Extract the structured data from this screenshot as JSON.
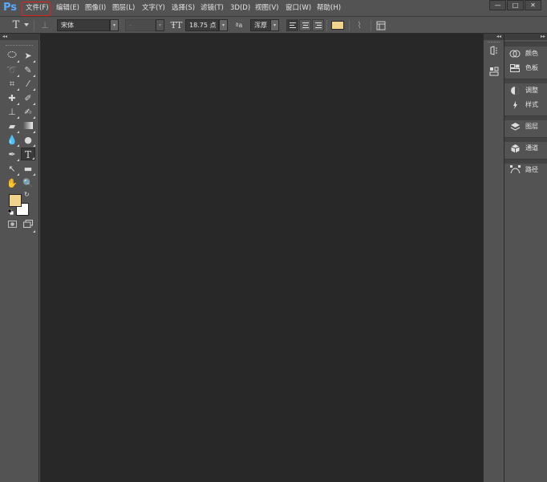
{
  "app": {
    "logo_text": "Ps"
  },
  "menu": {
    "items": [
      {
        "label": "文件(F)"
      },
      {
        "label": "编辑(E)"
      },
      {
        "label": "图像(I)"
      },
      {
        "label": "图层(L)"
      },
      {
        "label": "文字(Y)"
      },
      {
        "label": "选择(S)"
      },
      {
        "label": "滤镜(T)"
      },
      {
        "label": "3D(D)"
      },
      {
        "label": "视图(V)"
      },
      {
        "label": "窗口(W)"
      },
      {
        "label": "帮助(H)"
      }
    ],
    "highlighted_item": "文件(F)",
    "highlight_color": "#e0241b"
  },
  "window_controls": {
    "minimize": "—",
    "maximize": "□",
    "close": "✕"
  },
  "options_bar": {
    "tool_icon": "T",
    "font_family": "宋体",
    "font_style": "-",
    "font_size": "18.75 点",
    "antialias": "浑厚",
    "aa_icon_text": "ªa",
    "text_color": "#f2d38c"
  },
  "canvas": {
    "background": "#282828"
  },
  "tools": {
    "foreground_color": "#f2d38c",
    "background_color": "#ffffff",
    "icons": [
      "marquee-icon",
      "move-icon",
      "lasso-icon",
      "quick-select-icon",
      "crop-icon",
      "eyedropper-icon",
      "healing-brush-icon",
      "brush-icon",
      "clone-stamp-icon",
      "history-brush-icon",
      "eraser-icon",
      "gradient-icon",
      "blur-icon",
      "dodge-icon",
      "pen-icon",
      "type-icon",
      "path-select-icon",
      "rectangle-icon",
      "hand-icon",
      "zoom-icon"
    ],
    "active_tool": "type-icon"
  },
  "right_panels": {
    "groups": [
      {
        "items": [
          {
            "label": "颜色",
            "icon": "color-wheel-icon"
          },
          {
            "label": "色板",
            "icon": "swatches-icon"
          }
        ]
      },
      {
        "items": [
          {
            "label": "调整",
            "icon": "adjustments-icon"
          },
          {
            "label": "样式",
            "icon": "styles-icon"
          }
        ]
      },
      {
        "items": [
          {
            "label": "图层",
            "icon": "layers-icon"
          }
        ]
      },
      {
        "items": [
          {
            "label": "通道",
            "icon": "channels-icon"
          }
        ]
      },
      {
        "items": [
          {
            "label": "路径",
            "icon": "paths-icon"
          }
        ]
      }
    ]
  }
}
